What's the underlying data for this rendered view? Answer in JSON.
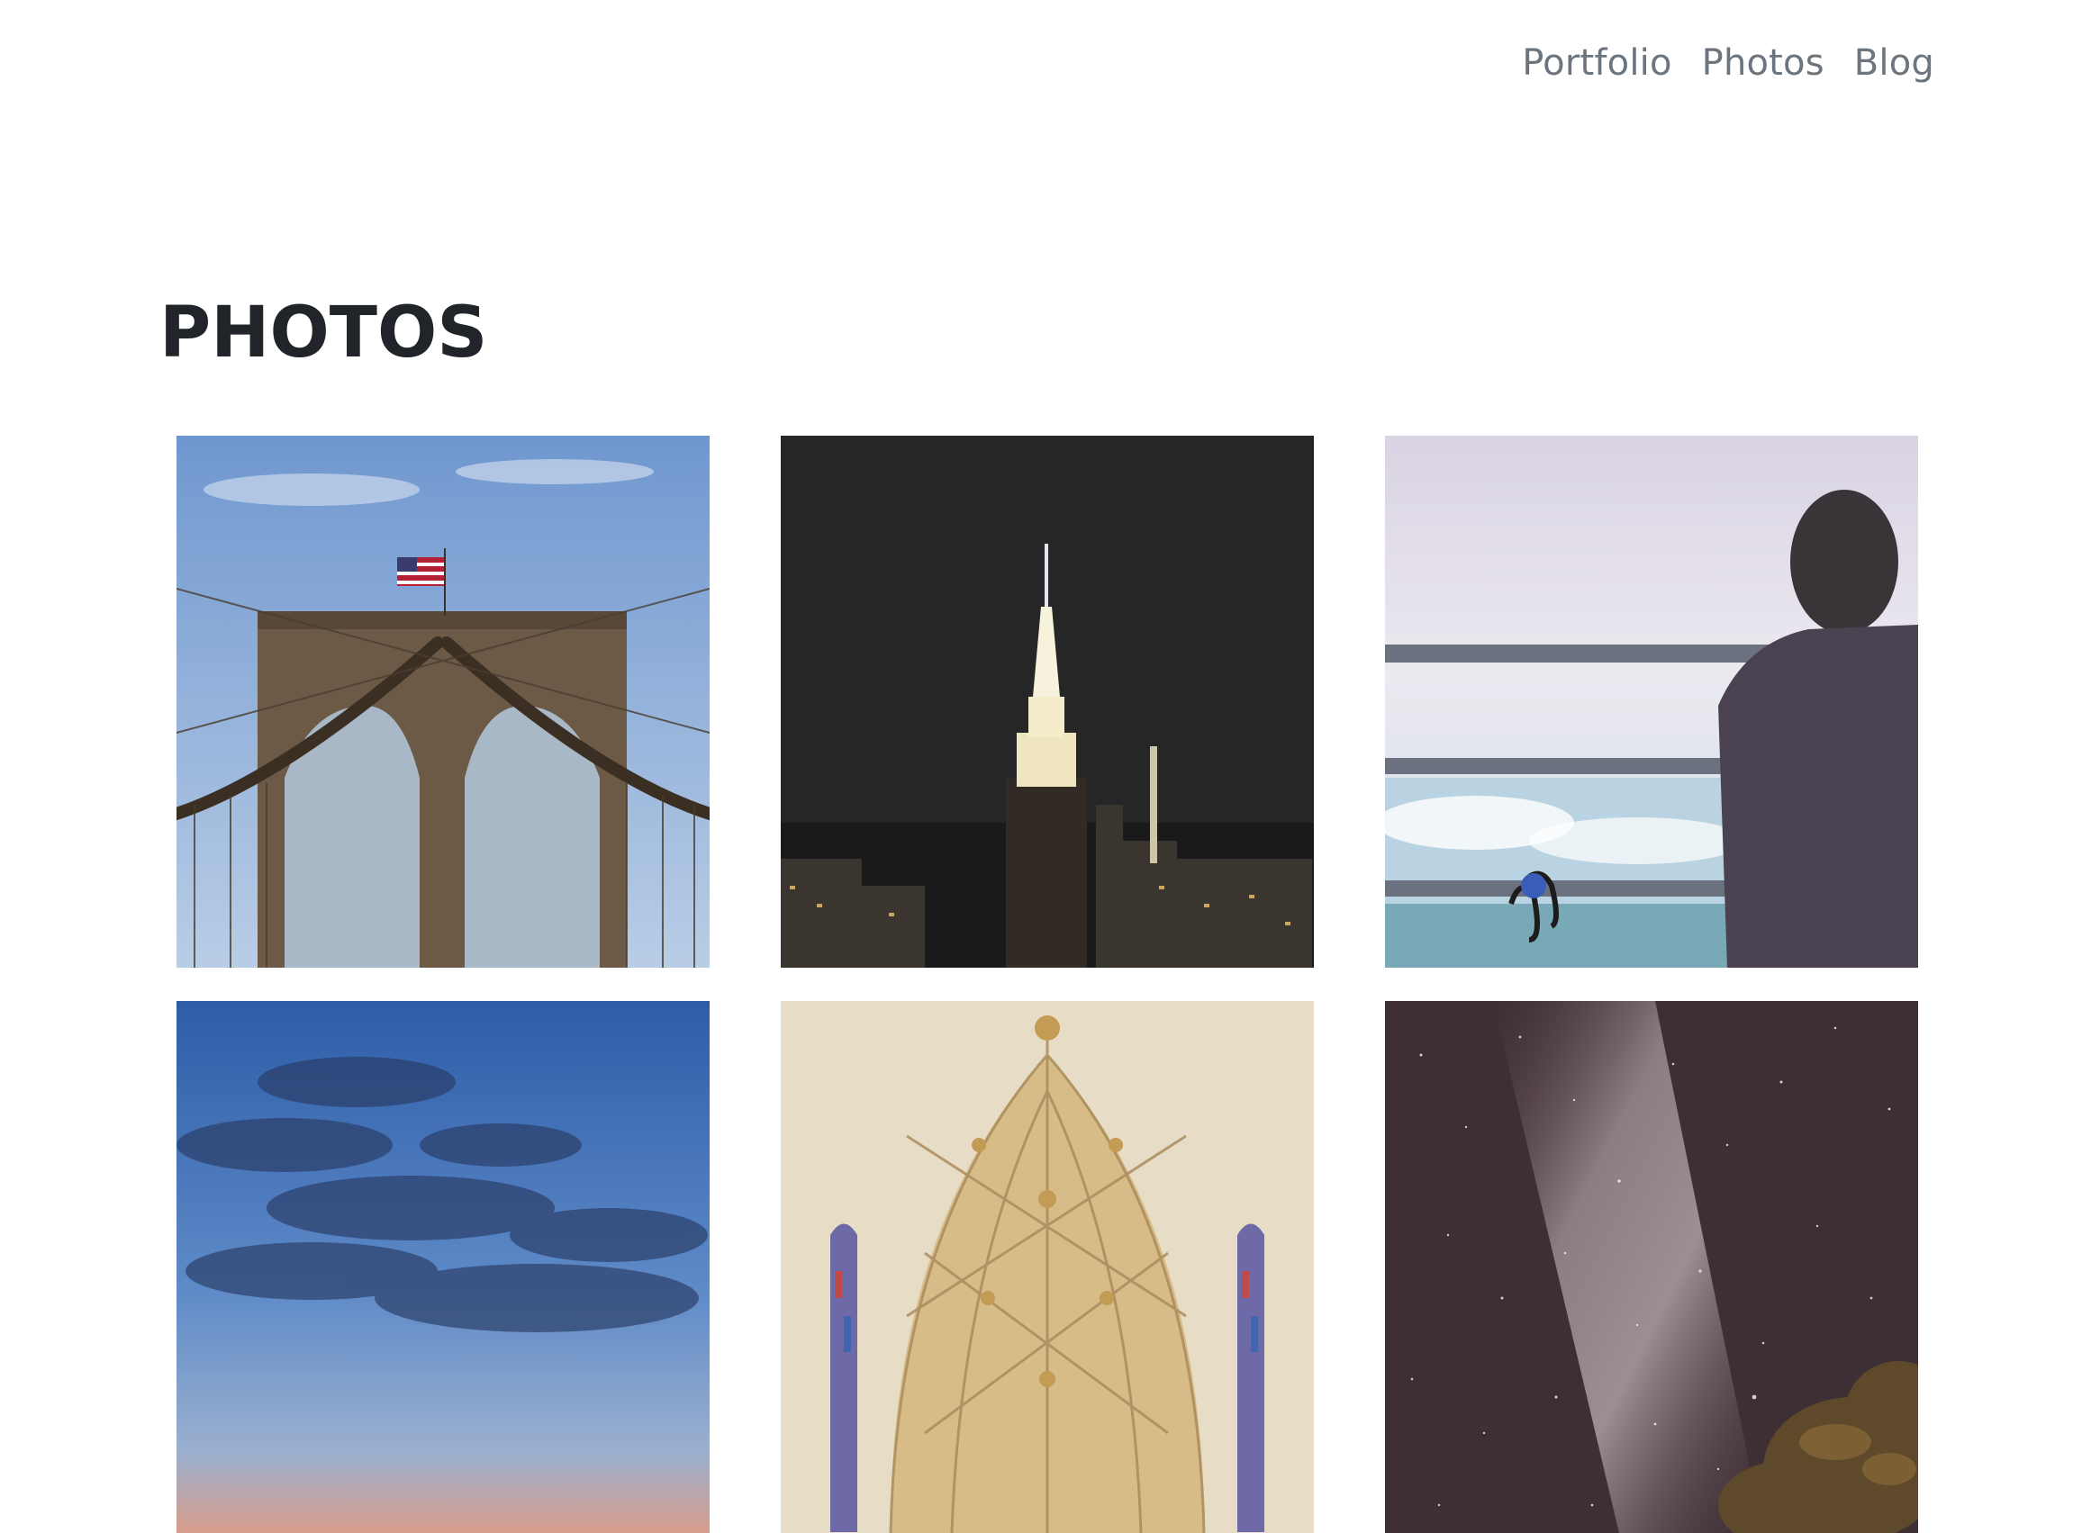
{
  "nav": {
    "items": [
      {
        "label": "Portfolio"
      },
      {
        "label": "Photos"
      },
      {
        "label": "Blog"
      }
    ]
  },
  "page": {
    "title": "PHOTOS"
  },
  "photos": [
    {
      "subject": "bridge-photo"
    },
    {
      "subject": "skyline-photo"
    },
    {
      "subject": "window-view-photo"
    },
    {
      "subject": "sky-photo"
    },
    {
      "subject": "cathedral-photo"
    },
    {
      "subject": "milky-way-photo"
    }
  ]
}
